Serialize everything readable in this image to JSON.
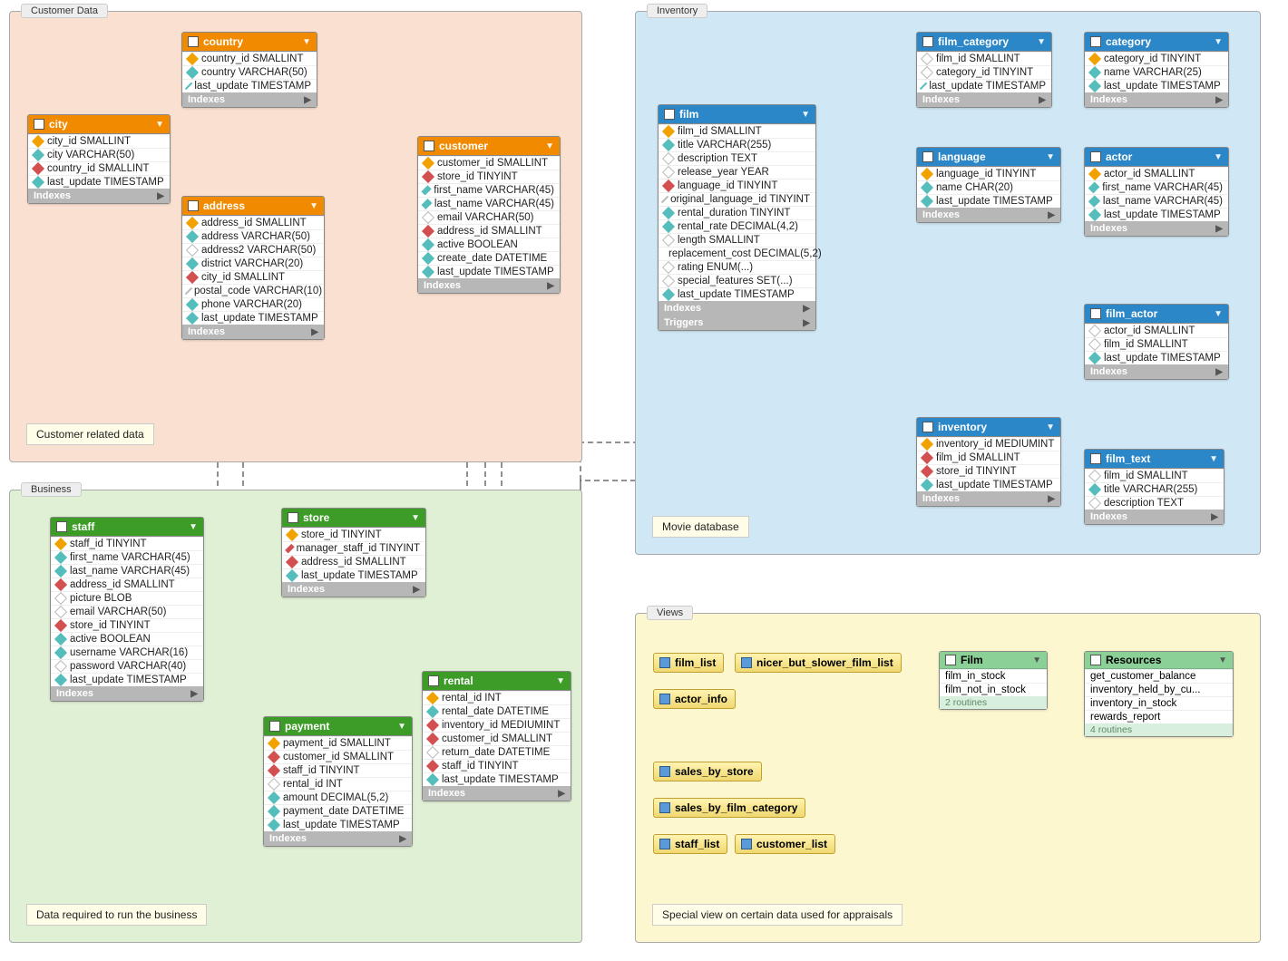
{
  "regions": {
    "customer": {
      "label": "Customer Data",
      "note": "Customer related data"
    },
    "business": {
      "label": "Business",
      "note": "Data required to run the business"
    },
    "inventory": {
      "label": "Inventory",
      "note": "Movie database"
    },
    "views": {
      "label": "Views",
      "note": "Special view on certain data used for appraisals"
    }
  },
  "tables": {
    "country": {
      "title": "country",
      "columns": [
        {
          "icon": "key",
          "text": "country_id SMALLINT"
        },
        {
          "icon": "idx",
          "text": "country VARCHAR(50)"
        },
        {
          "icon": "idx",
          "text": "last_update TIMESTAMP"
        }
      ],
      "sections": [
        "Indexes"
      ]
    },
    "city": {
      "title": "city",
      "columns": [
        {
          "icon": "key",
          "text": "city_id SMALLINT"
        },
        {
          "icon": "idx",
          "text": "city VARCHAR(50)"
        },
        {
          "icon": "fk",
          "text": "country_id SMALLINT"
        },
        {
          "icon": "idx",
          "text": "last_update TIMESTAMP"
        }
      ],
      "sections": [
        "Indexes"
      ]
    },
    "address": {
      "title": "address",
      "columns": [
        {
          "icon": "key",
          "text": "address_id SMALLINT"
        },
        {
          "icon": "idx",
          "text": "address VARCHAR(50)"
        },
        {
          "icon": "plain",
          "text": "address2 VARCHAR(50)"
        },
        {
          "icon": "idx",
          "text": "district VARCHAR(20)"
        },
        {
          "icon": "fk",
          "text": "city_id SMALLINT"
        },
        {
          "icon": "plain",
          "text": "postal_code VARCHAR(10)"
        },
        {
          "icon": "idx",
          "text": "phone VARCHAR(20)"
        },
        {
          "icon": "idx",
          "text": "last_update TIMESTAMP"
        }
      ],
      "sections": [
        "Indexes"
      ]
    },
    "customer": {
      "title": "customer",
      "columns": [
        {
          "icon": "key",
          "text": "customer_id SMALLINT"
        },
        {
          "icon": "fk",
          "text": "store_id TINYINT"
        },
        {
          "icon": "idx",
          "text": "first_name VARCHAR(45)"
        },
        {
          "icon": "idx",
          "text": "last_name VARCHAR(45)"
        },
        {
          "icon": "plain",
          "text": "email VARCHAR(50)"
        },
        {
          "icon": "fk",
          "text": "address_id SMALLINT"
        },
        {
          "icon": "idx",
          "text": "active BOOLEAN"
        },
        {
          "icon": "idx",
          "text": "create_date DATETIME"
        },
        {
          "icon": "idx",
          "text": "last_update TIMESTAMP"
        }
      ],
      "sections": [
        "Indexes"
      ]
    },
    "film": {
      "title": "film",
      "columns": [
        {
          "icon": "key",
          "text": "film_id SMALLINT"
        },
        {
          "icon": "idx",
          "text": "title VARCHAR(255)"
        },
        {
          "icon": "plain",
          "text": "description TEXT"
        },
        {
          "icon": "plain",
          "text": "release_year YEAR"
        },
        {
          "icon": "fk",
          "text": "language_id TINYINT"
        },
        {
          "icon": "plain",
          "text": "original_language_id TINYINT"
        },
        {
          "icon": "idx",
          "text": "rental_duration TINYINT"
        },
        {
          "icon": "idx",
          "text": "rental_rate DECIMAL(4,2)"
        },
        {
          "icon": "plain",
          "text": "length SMALLINT"
        },
        {
          "icon": "idx",
          "text": "replacement_cost DECIMAL(5,2)"
        },
        {
          "icon": "plain",
          "text": "rating ENUM(...)"
        },
        {
          "icon": "plain",
          "text": "special_features SET(...)"
        },
        {
          "icon": "idx",
          "text": "last_update TIMESTAMP"
        }
      ],
      "sections": [
        "Indexes",
        "Triggers"
      ]
    },
    "film_category": {
      "title": "film_category",
      "columns": [
        {
          "icon": "plain",
          "text": "film_id SMALLINT"
        },
        {
          "icon": "plain",
          "text": "category_id TINYINT"
        },
        {
          "icon": "idx",
          "text": "last_update TIMESTAMP"
        }
      ],
      "sections": [
        "Indexes"
      ]
    },
    "category": {
      "title": "category",
      "columns": [
        {
          "icon": "key",
          "text": "category_id TINYINT"
        },
        {
          "icon": "idx",
          "text": "name VARCHAR(25)"
        },
        {
          "icon": "idx",
          "text": "last_update TIMESTAMP"
        }
      ],
      "sections": [
        "Indexes"
      ]
    },
    "language": {
      "title": "language",
      "columns": [
        {
          "icon": "key",
          "text": "language_id TINYINT"
        },
        {
          "icon": "idx",
          "text": "name CHAR(20)"
        },
        {
          "icon": "idx",
          "text": "last_update TIMESTAMP"
        }
      ],
      "sections": [
        "Indexes"
      ]
    },
    "actor": {
      "title": "actor",
      "columns": [
        {
          "icon": "key",
          "text": "actor_id SMALLINT"
        },
        {
          "icon": "idx",
          "text": "first_name VARCHAR(45)"
        },
        {
          "icon": "idx",
          "text": "last_name VARCHAR(45)"
        },
        {
          "icon": "idx",
          "text": "last_update TIMESTAMP"
        }
      ],
      "sections": [
        "Indexes"
      ]
    },
    "film_actor": {
      "title": "film_actor",
      "columns": [
        {
          "icon": "plain",
          "text": "actor_id SMALLINT"
        },
        {
          "icon": "plain",
          "text": "film_id SMALLINT"
        },
        {
          "icon": "idx",
          "text": "last_update TIMESTAMP"
        }
      ],
      "sections": [
        "Indexes"
      ]
    },
    "inventory": {
      "title": "inventory",
      "columns": [
        {
          "icon": "key",
          "text": "inventory_id MEDIUMINT"
        },
        {
          "icon": "fk",
          "text": "film_id SMALLINT"
        },
        {
          "icon": "fk",
          "text": "store_id TINYINT"
        },
        {
          "icon": "idx",
          "text": "last_update TIMESTAMP"
        }
      ],
      "sections": [
        "Indexes"
      ]
    },
    "film_text": {
      "title": "film_text",
      "columns": [
        {
          "icon": "plain",
          "text": "film_id SMALLINT"
        },
        {
          "icon": "idx",
          "text": "title VARCHAR(255)"
        },
        {
          "icon": "plain",
          "text": "description TEXT"
        }
      ],
      "sections": [
        "Indexes"
      ]
    },
    "staff": {
      "title": "staff",
      "columns": [
        {
          "icon": "key",
          "text": "staff_id TINYINT"
        },
        {
          "icon": "idx",
          "text": "first_name VARCHAR(45)"
        },
        {
          "icon": "idx",
          "text": "last_name VARCHAR(45)"
        },
        {
          "icon": "fk",
          "text": "address_id SMALLINT"
        },
        {
          "icon": "plain",
          "text": "picture BLOB"
        },
        {
          "icon": "plain",
          "text": "email VARCHAR(50)"
        },
        {
          "icon": "fk",
          "text": "store_id TINYINT"
        },
        {
          "icon": "idx",
          "text": "active BOOLEAN"
        },
        {
          "icon": "idx",
          "text": "username VARCHAR(16)"
        },
        {
          "icon": "plain",
          "text": "password VARCHAR(40)"
        },
        {
          "icon": "idx",
          "text": "last_update TIMESTAMP"
        }
      ],
      "sections": [
        "Indexes"
      ]
    },
    "store": {
      "title": "store",
      "columns": [
        {
          "icon": "key",
          "text": "store_id TINYINT"
        },
        {
          "icon": "fk",
          "text": "manager_staff_id TINYINT"
        },
        {
          "icon": "fk",
          "text": "address_id SMALLINT"
        },
        {
          "icon": "idx",
          "text": "last_update TIMESTAMP"
        }
      ],
      "sections": [
        "Indexes"
      ]
    },
    "payment": {
      "title": "payment",
      "columns": [
        {
          "icon": "key",
          "text": "payment_id SMALLINT"
        },
        {
          "icon": "fk",
          "text": "customer_id SMALLINT"
        },
        {
          "icon": "fk",
          "text": "staff_id TINYINT"
        },
        {
          "icon": "plain",
          "text": "rental_id INT"
        },
        {
          "icon": "idx",
          "text": "amount DECIMAL(5,2)"
        },
        {
          "icon": "idx",
          "text": "payment_date DATETIME"
        },
        {
          "icon": "idx",
          "text": "last_update TIMESTAMP"
        }
      ],
      "sections": [
        "Indexes"
      ]
    },
    "rental": {
      "title": "rental",
      "columns": [
        {
          "icon": "key",
          "text": "rental_id INT"
        },
        {
          "icon": "idx",
          "text": "rental_date DATETIME"
        },
        {
          "icon": "fk",
          "text": "inventory_id MEDIUMINT"
        },
        {
          "icon": "fk",
          "text": "customer_id SMALLINT"
        },
        {
          "icon": "plain",
          "text": "return_date DATETIME"
        },
        {
          "icon": "fk",
          "text": "staff_id TINYINT"
        },
        {
          "icon": "idx",
          "text": "last_update TIMESTAMP"
        }
      ],
      "sections": [
        "Indexes"
      ]
    }
  },
  "views": {
    "chips": [
      "film_list",
      "nicer_but_slower_film_list",
      "actor_info",
      "sales_by_store",
      "sales_by_film_category",
      "staff_list",
      "customer_list"
    ],
    "film_group": {
      "title": "Film",
      "items": [
        "film_in_stock",
        "film_not_in_stock"
      ],
      "footer": "2 routines"
    },
    "resources_group": {
      "title": "Resources",
      "items": [
        "get_customer_balance",
        "inventory_held_by_cu...",
        "inventory_in_stock",
        "rewards_report"
      ],
      "footer": "4 routines"
    }
  }
}
